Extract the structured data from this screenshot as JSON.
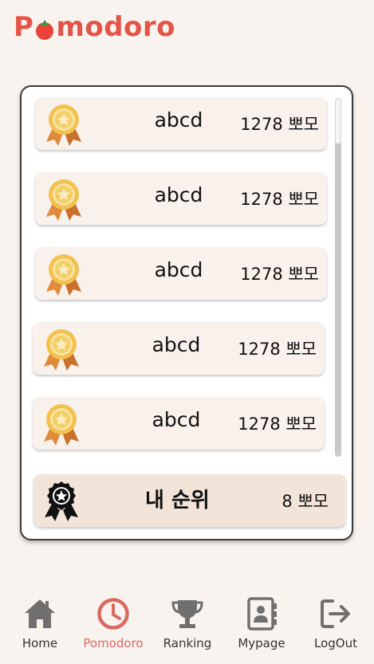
{
  "app": {
    "title_before": "P",
    "title_after": "modoro"
  },
  "ranking": {
    "rows": [
      {
        "name": "abcd",
        "score": "1278 뽀모"
      },
      {
        "name": "abcd",
        "score": "1278 뽀모"
      },
      {
        "name": "abcd",
        "score": "1278 뽀모"
      },
      {
        "name": "abcd",
        "score": "1278 뽀모"
      },
      {
        "name": "abcd",
        "score": "1278 뽀모"
      }
    ],
    "my_rank": {
      "label": "내 순위",
      "score": "8 뽀모"
    }
  },
  "nav": {
    "items": [
      {
        "label": "Home",
        "icon": "home-icon"
      },
      {
        "label": "Pomodoro",
        "icon": "clock-icon"
      },
      {
        "label": "Ranking",
        "icon": "trophy-icon"
      },
      {
        "label": "Mypage",
        "icon": "contact-book-icon"
      },
      {
        "label": "LogOut",
        "icon": "logout-icon"
      }
    ],
    "active": "Pomodoro"
  },
  "colors": {
    "brand": "#e25548",
    "background": "#f8f3ef",
    "row_background": "#f8f1ec",
    "my_rank_background": "#f2e4d8",
    "nav_icon": "#6f6f6f",
    "nav_active": "#d96a63"
  }
}
